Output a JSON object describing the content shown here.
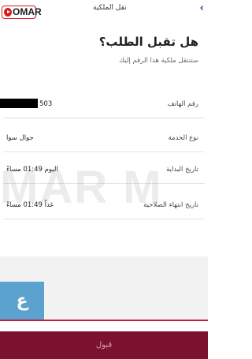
{
  "header": {
    "title": "نقل الملكية",
    "back_icon": "chevron-right-icon"
  },
  "branding": {
    "badge_text": "OMAR",
    "watermark_text": "MAR M",
    "logo_text": "ع"
  },
  "question": {
    "title": "هل تقبل الطلب؟",
    "subtitle": "ستنتقل ملكية هذا الرقم إليك"
  },
  "details": [
    {
      "label": "رقم الهاتف",
      "value": "503"
    },
    {
      "label": "نوع الخدمة",
      "value": "جوال سوا"
    },
    {
      "label": "تاريخ البداية",
      "value": "اليوم 01:49 مساءً"
    },
    {
      "label": "تاريخ انتهاء الصلاحية",
      "value": "غداً 01:49 مساءً"
    }
  ],
  "actions": {
    "accept_label": "قبول"
  },
  "colors": {
    "accent": "#7d1230",
    "brand_red": "#d81b1b",
    "back_arrow": "#4b2b8a"
  }
}
